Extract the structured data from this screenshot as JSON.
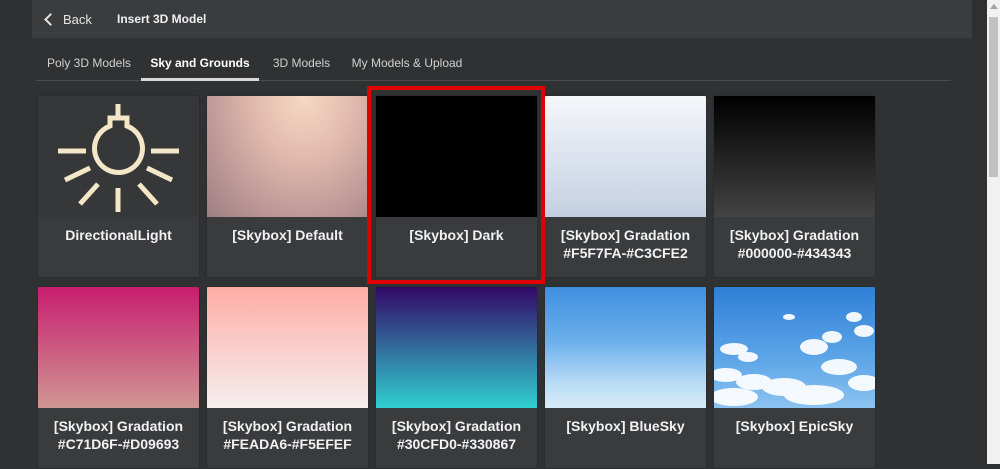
{
  "header": {
    "back_label": "Back",
    "title": "Insert 3D Model"
  },
  "tabs": [
    {
      "label": "Poly 3D Models",
      "active": false
    },
    {
      "label": "Sky and Grounds",
      "active": true
    },
    {
      "label": "3D Models",
      "active": false
    },
    {
      "label": "My Models & Upload",
      "active": false
    }
  ],
  "cards": [
    {
      "label": "DirectionalLight",
      "thumb": "lightbulb-icon"
    },
    {
      "label": "[Skybox] Default"
    },
    {
      "label": "[Skybox] Dark",
      "selected": true
    },
    {
      "label": "[Skybox] Gradation\n#F5F7FA-#C3CFE2"
    },
    {
      "label": "[Skybox] Gradation\n#000000-#434343"
    },
    {
      "label": "[Skybox] Gradation\n#C71D6F-#D09693"
    },
    {
      "label": "[Skybox] Gradation\n#FEADA6-#F5EFEF"
    },
    {
      "label": "[Skybox] Gradation\n#30CFD0-#330867"
    },
    {
      "label": "[Skybox] BlueSky"
    },
    {
      "label": "[Skybox] EpicSky"
    }
  ],
  "colors": {
    "highlight": "#e00000",
    "icon": "#f3e7c8",
    "background": "#2f3133"
  }
}
